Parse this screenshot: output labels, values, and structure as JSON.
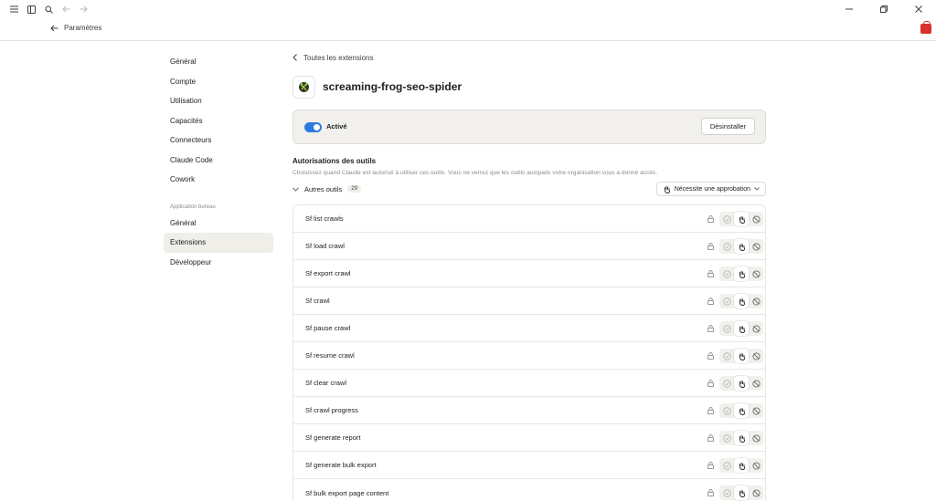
{
  "titlebar": {
    "icons": [
      "menu-icon",
      "sidebar-toggle-icon",
      "search-icon",
      "back-arrow-icon",
      "forward-arrow-icon"
    ],
    "window_controls": [
      "minimize-icon",
      "restore-icon",
      "close-icon"
    ]
  },
  "header": {
    "back_label": "Paramètres"
  },
  "sidebar": {
    "items": [
      {
        "label": "Général"
      },
      {
        "label": "Compte"
      },
      {
        "label": "Utilisation"
      },
      {
        "label": "Capacités"
      },
      {
        "label": "Connecteurs"
      },
      {
        "label": "Claude Code"
      },
      {
        "label": "Cowork"
      }
    ],
    "section_label": "Application bureau",
    "desktop_items": [
      {
        "label": "Général"
      },
      {
        "label": "Extensions",
        "active": true
      },
      {
        "label": "Développeur"
      }
    ]
  },
  "main": {
    "back_label": "Toutes les extensions",
    "extension_name": "screaming-frog-seo-spider",
    "status_label": "Activé",
    "toggle_on": true,
    "uninstall_label": "Désinstaller",
    "permissions_title": "Autorisations des outils",
    "permissions_description": "Choisissez quand Claude est autorisé à utiliser ces outils. Vous ne verrez que les outils auxquels votre organisation vous a donné accès.",
    "group_label": "Autres outils",
    "group_count": "29",
    "approval_label": "Nécessite une approbation",
    "accent_color": "#2c7ae0",
    "tools": [
      {
        "name": "Sf list crawls"
      },
      {
        "name": "Sf load crawl"
      },
      {
        "name": "Sf export crawl"
      },
      {
        "name": "Sf crawl"
      },
      {
        "name": "Sf pause crawl"
      },
      {
        "name": "Sf resume crawl"
      },
      {
        "name": "Sf clear crawl"
      },
      {
        "name": "Sf crawl progress"
      },
      {
        "name": "Sf generate report"
      },
      {
        "name": "Sf generate bulk export"
      },
      {
        "name": "Sf bulk export page content"
      }
    ]
  }
}
